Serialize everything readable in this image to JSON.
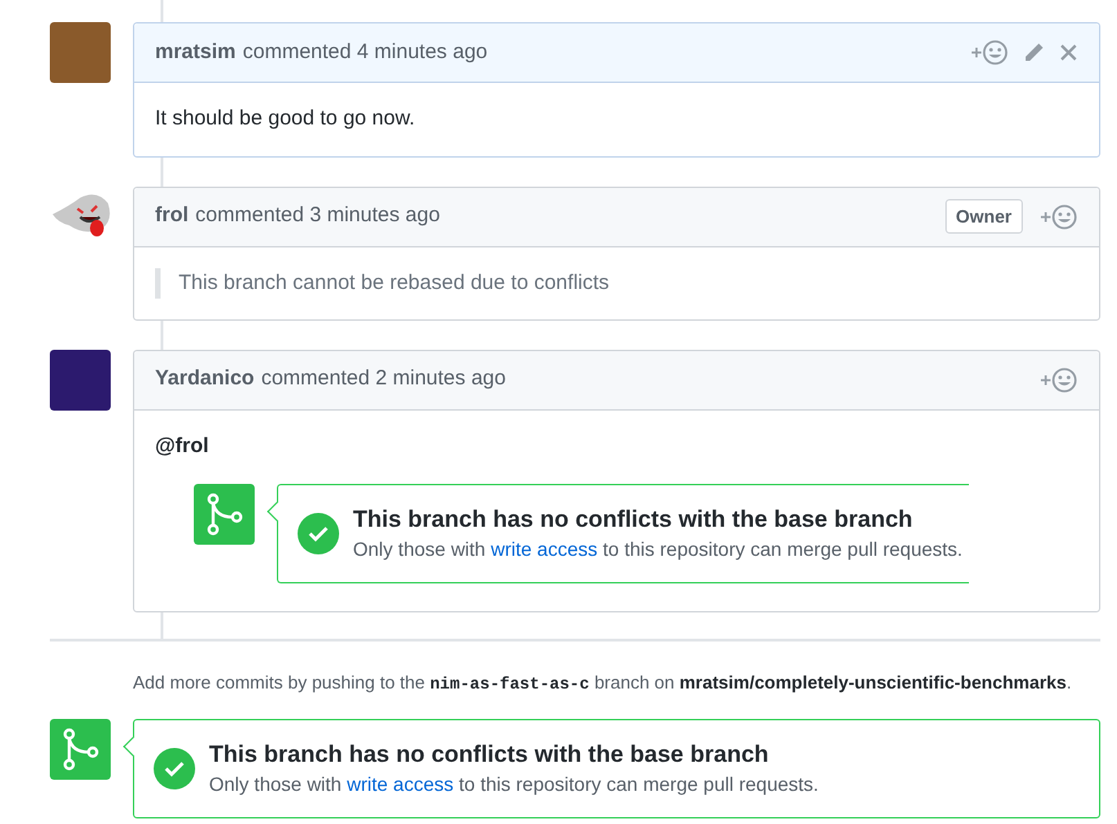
{
  "comments": [
    {
      "author": "mratsim",
      "meta": "commented 4 minutes ago",
      "avatar": {
        "kind": "photo"
      },
      "highlighted": true,
      "actions": [
        {
          "kind": "reaction"
        },
        {
          "kind": "edit"
        },
        {
          "kind": "delete"
        }
      ],
      "body": [
        {
          "kind": "text",
          "text": "It should be good to go now."
        }
      ]
    },
    {
      "author": "frol",
      "meta": "commented 3 minutes ago",
      "avatar": {
        "kind": "ghost"
      },
      "highlighted": false,
      "badge": "Owner",
      "actions": [
        {
          "kind": "reaction"
        }
      ],
      "body": [
        {
          "kind": "quote",
          "text": "This branch cannot be rebased due to conflicts"
        }
      ]
    },
    {
      "author": "Yardanico",
      "meta": "commented 2 minutes ago",
      "avatar": {
        "kind": "poster"
      },
      "highlighted": false,
      "actions": [
        {
          "kind": "reaction"
        }
      ],
      "body": [
        {
          "kind": "mention",
          "text": "@frol"
        },
        {
          "kind": "merge_status",
          "title": "This branch has no conflicts with the base branch",
          "before": "Only those with ",
          "link": "write access",
          "after": " to this repository can merge pull requests."
        }
      ]
    }
  ],
  "push_note": {
    "before": "Add more commits by pushing to the ",
    "branch": "nim-as-fast-as-c",
    "middle": " branch on ",
    "repo": "mratsim/completely-unscientific-benchmarks",
    "after": "."
  },
  "merge_status": {
    "title": "This branch has no conflicts with the base branch",
    "before": "Only those with ",
    "link": "write access",
    "after": " to this repository can merge pull requests."
  }
}
